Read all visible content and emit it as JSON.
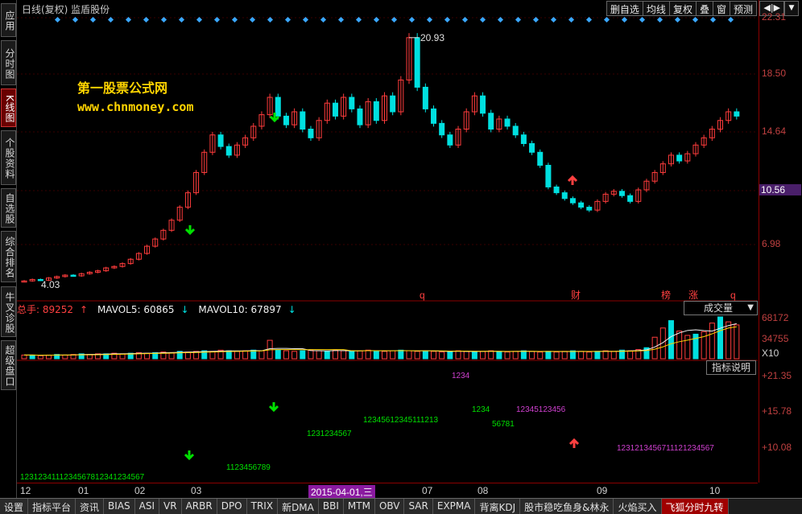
{
  "left_nav": {
    "items": [
      {
        "label": "应用",
        "active": false
      },
      {
        "label": "分时图",
        "active": false
      },
      {
        "label": "K线图",
        "active": true
      },
      {
        "label": "个股资料",
        "active": false
      },
      {
        "label": "自选股",
        "active": false
      },
      {
        "label": "综合排名",
        "active": false
      },
      {
        "label": "牛叉诊股",
        "active": false
      },
      {
        "label": "超级盘口",
        "active": false
      }
    ]
  },
  "header": {
    "title": "日线(复权)  监盾股份",
    "buttons": [
      "删自选",
      "均线",
      "复权",
      "叠",
      "窗",
      "预测"
    ],
    "arrow_label": "◀|▶"
  },
  "watermark": {
    "line1": "第一股票公式网",
    "line2": "www.chnmoney.com"
  },
  "price_axis": {
    "labels": [
      "22.31",
      "18.50",
      "14.64",
      "10.56",
      "6.98"
    ],
    "current": "10.56"
  },
  "annotations": {
    "high": "20.93",
    "low": "4.03",
    "markers": [
      "q",
      "财",
      "榜",
      "涨",
      "q"
    ]
  },
  "volume": {
    "total_label": "总手: 89252",
    "mavol5": "MAVOL5: 60865",
    "mavol10": "MAVOL10: 67897",
    "selector": "成交量",
    "axis": [
      "68172",
      "34755",
      "X10"
    ]
  },
  "indicator": {
    "button": "指标说明",
    "axis": [
      "+21.35",
      "+15.78",
      "+10.08"
    ]
  },
  "date_axis": {
    "labels": [
      "12",
      "01",
      "02",
      "03",
      "2015-04-01,三",
      "07",
      "08",
      "09",
      "10"
    ]
  },
  "tabs": [
    "设置",
    "指标平台",
    "资讯",
    "BIAS",
    "ASI",
    "VR",
    "ARBR",
    "DPO",
    "TRIX",
    "新DMA",
    "BBI",
    "MTM",
    "OBV",
    "SAR",
    "EXPMA",
    "背离KDJ",
    "股市稳吃鱼身&林永",
    "火焰买入",
    "飞狐分时九转"
  ],
  "active_tab": "飞狐分时九转",
  "colors": {
    "up": "#ff3c3c",
    "down": "#00e0e0",
    "accent": "#ffd400",
    "signal_green": "#00e000",
    "signal_purple": "#d040d0"
  },
  "chart_data": {
    "type": "candlestick",
    "title": "",
    "ylim": [
      3.5,
      22.31
    ],
    "y_ticks": [
      22.31,
      18.5,
      14.64,
      10.56,
      6.98
    ],
    "close_series": [
      4.1,
      4.2,
      4.15,
      4.3,
      4.4,
      4.5,
      4.45,
      4.6,
      4.7,
      4.8,
      5.0,
      5.1,
      5.3,
      5.6,
      6.0,
      6.5,
      7.0,
      7.6,
      8.3,
      9.2,
      10.2,
      11.6,
      13.0,
      14.2,
      13.4,
      12.8,
      13.5,
      14.0,
      14.8,
      15.6,
      16.8,
      15.5,
      14.9,
      15.8,
      14.6,
      14.0,
      15.2,
      16.4,
      15.5,
      16.8,
      16.0,
      14.9,
      16.5,
      15.2,
      16.9,
      15.8,
      18.0,
      20.93,
      17.5,
      16.0,
      15.0,
      14.2,
      13.5,
      14.6,
      15.8,
      16.9,
      15.7,
      14.6,
      15.3,
      14.8,
      14.2,
      13.6,
      13.0,
      12.1,
      10.6,
      10.2,
      9.8,
      9.5,
      9.2,
      9.0,
      9.6,
      10.1,
      10.3,
      10.0,
      9.6,
      10.4,
      11.0,
      11.6,
      12.2,
      12.8,
      12.4,
      12.9,
      13.5,
      14.0,
      14.6,
      15.2,
      15.8,
      15.5
    ],
    "volume_series": [
      6,
      6,
      5,
      6,
      7,
      6,
      7,
      8,
      7,
      8,
      8,
      9,
      8,
      9,
      10,
      9,
      10,
      11,
      10,
      12,
      11,
      12,
      13,
      12,
      14,
      13,
      12,
      13,
      14,
      13,
      30,
      14,
      13,
      12,
      13,
      14,
      13,
      12,
      14,
      13,
      12,
      13,
      14,
      13,
      12,
      13,
      14,
      13,
      12,
      13,
      12,
      11,
      12,
      13,
      12,
      11,
      12,
      13,
      12,
      11,
      12,
      13,
      12,
      11,
      12,
      11,
      12,
      13,
      12,
      11,
      12,
      13,
      12,
      14,
      13,
      15,
      18,
      35,
      50,
      62,
      45,
      38,
      40,
      44,
      58,
      68,
      60,
      55
    ]
  }
}
